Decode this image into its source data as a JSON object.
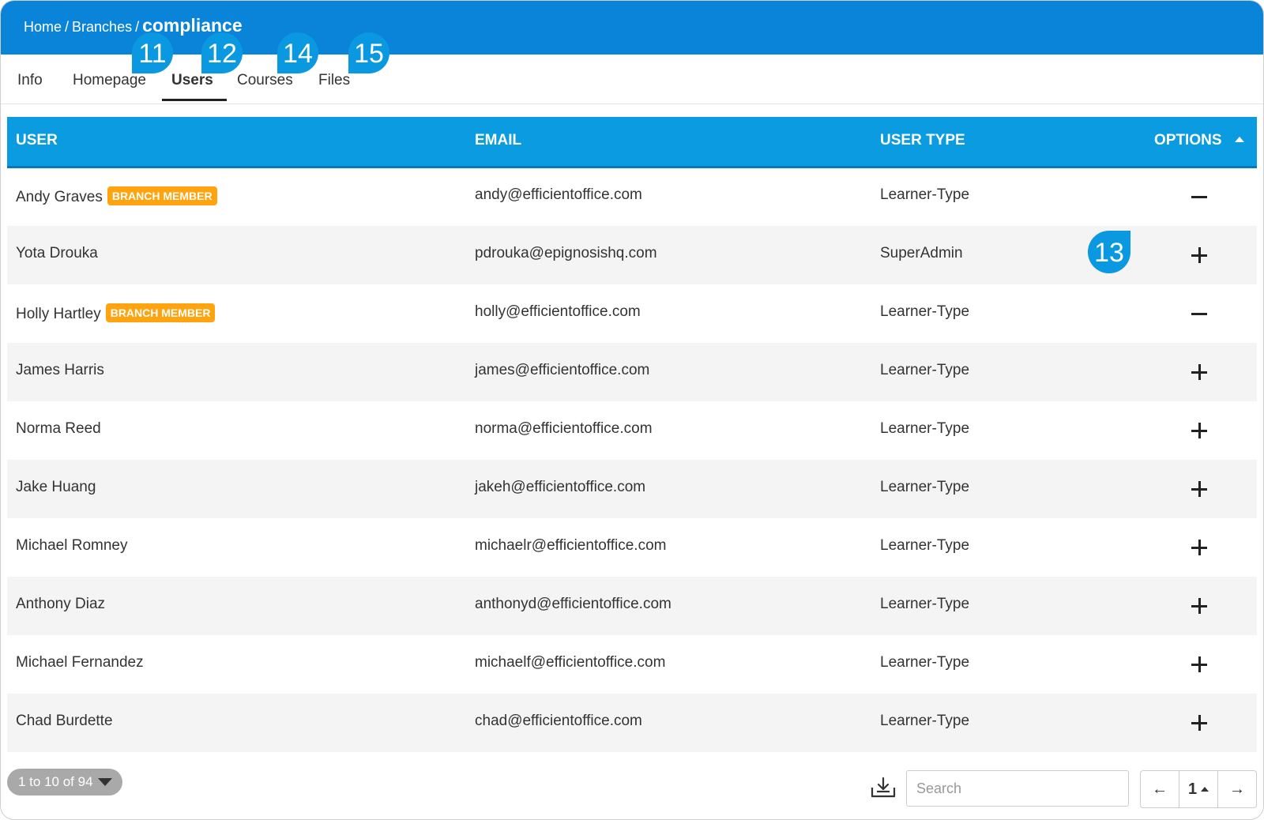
{
  "breadcrumb": {
    "home": "Home",
    "sep": "/",
    "branches": "Branches",
    "current": "compliance"
  },
  "tabs": [
    {
      "label": "Info"
    },
    {
      "label": "Homepage"
    },
    {
      "label": "Users"
    },
    {
      "label": "Courses"
    },
    {
      "label": "Files"
    }
  ],
  "callouts": {
    "homepage": "11",
    "users": "12",
    "options": "13",
    "courses": "14",
    "files": "15"
  },
  "table": {
    "headers": {
      "user": "USER",
      "email": "EMAIL",
      "user_type": "USER TYPE",
      "options": "OPTIONS"
    },
    "rows": [
      {
        "name": "Andy Graves",
        "badge": "BRANCH MEMBER",
        "email": "andy@efficientoffice.com",
        "type": "Learner-Type",
        "option": "remove"
      },
      {
        "name": "Yota Drouka",
        "badge": "",
        "email": "pdrouka@epignosishq.com",
        "type": "SuperAdmin",
        "option": "add"
      },
      {
        "name": "Holly Hartley",
        "badge": "BRANCH MEMBER",
        "email": "holly@efficientoffice.com",
        "type": "Learner-Type",
        "option": "remove"
      },
      {
        "name": "James Harris",
        "badge": "",
        "email": "james@efficientoffice.com",
        "type": "Learner-Type",
        "option": "add"
      },
      {
        "name": "Norma Reed",
        "badge": "",
        "email": "norma@efficientoffice.com",
        "type": "Learner-Type",
        "option": "add"
      },
      {
        "name": "Jake Huang",
        "badge": "",
        "email": "jakeh@efficientoffice.com",
        "type": "Learner-Type",
        "option": "add"
      },
      {
        "name": "Michael Romney",
        "badge": "",
        "email": "michaelr@efficientoffice.com",
        "type": "Learner-Type",
        "option": "add"
      },
      {
        "name": "Anthony Diaz",
        "badge": "",
        "email": "anthonyd@efficientoffice.com",
        "type": "Learner-Type",
        "option": "add"
      },
      {
        "name": "Michael Fernandez",
        "badge": "",
        "email": "michaelf@efficientoffice.com",
        "type": "Learner-Type",
        "option": "add"
      },
      {
        "name": "Chad Burdette",
        "badge": "",
        "email": "chad@efficientoffice.com",
        "type": "Learner-Type",
        "option": "add"
      }
    ]
  },
  "footer": {
    "count_label": "1 to 10 of 94",
    "search_placeholder": "Search",
    "pager_prev": "←",
    "pager_page": "1",
    "pager_next": "→"
  },
  "colors": {
    "header": "#0a84d8",
    "table_header": "#0a9be0",
    "badge": "#ffa30f",
    "callout": "#0a98e0"
  }
}
